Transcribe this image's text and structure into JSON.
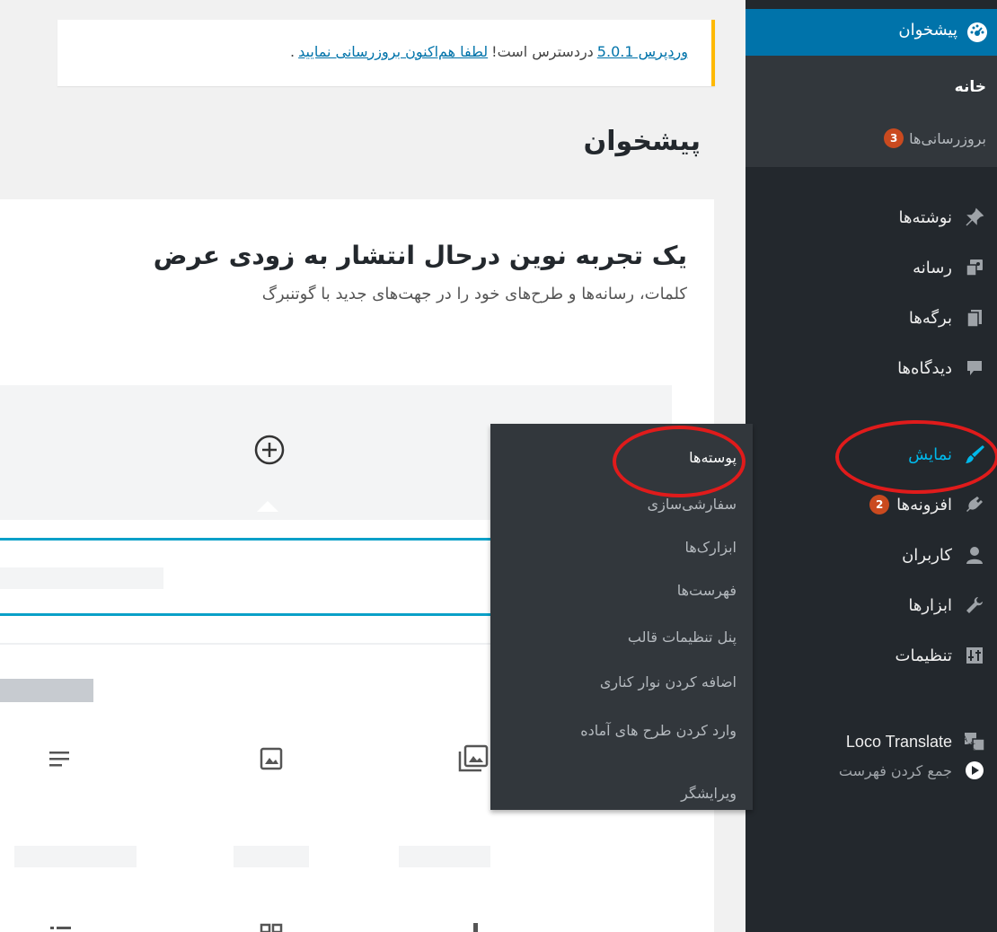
{
  "notice": {
    "wordpress_link": "وردپرس 5.0.1",
    "middle": "دردسترس است!",
    "update_link": "لطفا هم‌اکنون بروزرسانی نمایید",
    "period": "."
  },
  "page": {
    "title": "پیشخوان"
  },
  "welcome": {
    "heading": "یک تجربه نوین درحال انتشار به زودی عرض",
    "subtext": "کلمات، رسانه‌ها و طرح‌های خود را در جهت‌های جدید با گوتنبرگ"
  },
  "sidebar": {
    "dashboard": {
      "label": "پیشخوان",
      "icon": "dashboard-icon"
    },
    "sub": {
      "home": "خانه",
      "updates": "بروزرسانی‌ها",
      "updates_count": "3"
    },
    "items": [
      {
        "label": "نوشته‌ها",
        "icon": "pin-icon"
      },
      {
        "label": "رسانه",
        "icon": "media-icon"
      },
      {
        "label": "برگه‌ها",
        "icon": "page-icon"
      },
      {
        "label": "دیدگاه‌ها",
        "icon": "comment-icon"
      },
      {
        "label": "نمایش",
        "icon": "brush-icon"
      },
      {
        "label": "افزونه‌ها",
        "icon": "plugin-icon",
        "badge": "2"
      },
      {
        "label": "کاربران",
        "icon": "user-icon"
      },
      {
        "label": "ابزارها",
        "icon": "wrench-icon"
      },
      {
        "label": "تنظیمات",
        "icon": "settings-icon"
      },
      {
        "label": "Loco Translate",
        "icon": "translate-icon"
      },
      {
        "label": "جمع کردن فهرست",
        "icon": "collapse-icon"
      }
    ]
  },
  "flyout": {
    "items": [
      "پوسته‌ها",
      "سفارشی‌سازی",
      "ابزارک‌ها",
      "فهرست‌ها",
      "پنل تنظیمات قالب",
      "اضافه کردن نوار کناری",
      "وارد کردن طرح های آماده",
      "ویرایشگر"
    ]
  },
  "colors": {
    "sidebar_bg": "#23282d",
    "submenu_bg": "#32373c",
    "accent": "#0073aa",
    "active_text": "#00b9eb",
    "badge": "#ca4a1f",
    "notice_border": "#ffb900",
    "annotation": "#e01b1b"
  }
}
